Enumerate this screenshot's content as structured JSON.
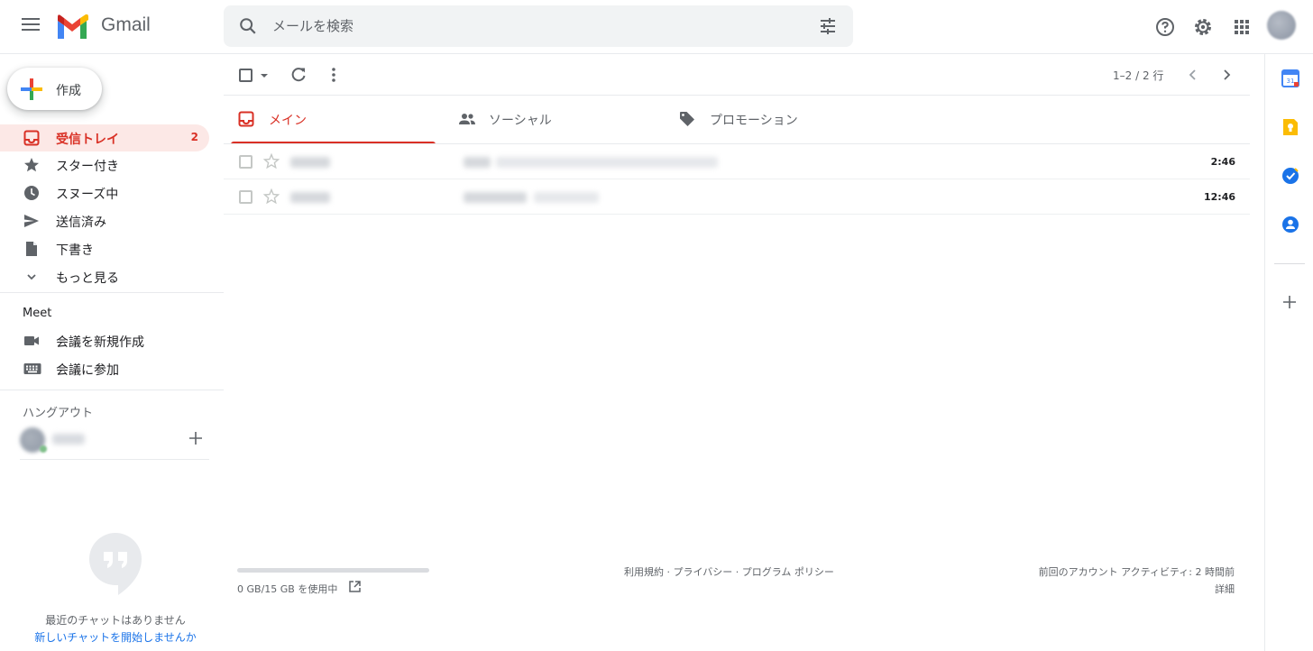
{
  "header": {
    "app_name": "Gmail",
    "search_placeholder": "メールを検索"
  },
  "sidebar": {
    "compose_label": "作成",
    "items": [
      {
        "label": "受信トレイ",
        "count": "2",
        "icon": "inbox-icon",
        "active": true
      },
      {
        "label": "スター付き",
        "icon": "star-icon"
      },
      {
        "label": "スヌーズ中",
        "icon": "clock-icon"
      },
      {
        "label": "送信済み",
        "icon": "send-icon"
      },
      {
        "label": "下書き",
        "icon": "draft-icon"
      },
      {
        "label": "もっと見る",
        "icon": "chevron-down-icon"
      }
    ],
    "meet": {
      "title": "Meet",
      "items": [
        {
          "label": "会議を新規作成",
          "icon": "videocam-icon"
        },
        {
          "label": "会議に参加",
          "icon": "keyboard-icon"
        }
      ]
    },
    "hangouts": {
      "title": "ハングアウト",
      "no_chats": "最近のチャットはありません",
      "start_chat": "新しいチャットを開始しませんか"
    }
  },
  "toolbar": {
    "pagination": "1–2 / 2 行"
  },
  "tabs": [
    {
      "label": "メイン",
      "icon": "inbox-icon",
      "active": true
    },
    {
      "label": "ソーシャル",
      "icon": "people-icon"
    },
    {
      "label": "プロモーション",
      "icon": "tag-icon"
    }
  ],
  "emails": [
    {
      "time": "2:46"
    },
    {
      "time": "12:46"
    }
  ],
  "footer": {
    "storage": "0 GB/15 GB を使用中",
    "storage_used_fraction": 0,
    "links": "利用規約 · プライバシー · プログラム ポリシー",
    "last_activity": "前回のアカウント アクティビティ: 2 時間前",
    "details": "詳細"
  },
  "colors": {
    "accent_red": "#d93025",
    "link_blue": "#1a73e8"
  }
}
